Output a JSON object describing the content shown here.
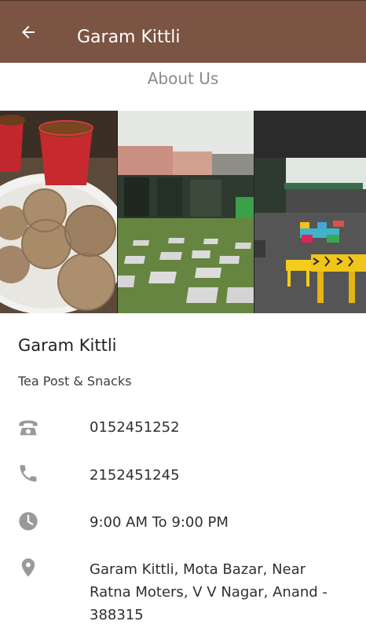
{
  "appbar": {
    "title": "Garam Kittli",
    "back_icon": "arrow-back-icon",
    "color": "#7b5444"
  },
  "section_title": "About Us",
  "gallery": {
    "images": [
      {
        "name": "tea-and-cookies-photo"
      },
      {
        "name": "courtyard-photo"
      },
      {
        "name": "seating-area-photo"
      }
    ]
  },
  "business": {
    "name": "Garam Kittli",
    "category": "Tea Post & Snacks"
  },
  "contact": {
    "landline": {
      "icon": "telephone-icon",
      "value": "0152451252"
    },
    "mobile": {
      "icon": "phone-icon",
      "value": "2152451245"
    },
    "hours": {
      "icon": "clock-icon",
      "value": "9:00 AM To 9:00 PM"
    },
    "address": {
      "icon": "location-pin-icon",
      "value": "Garam Kittli, Mota Bazar, Near Ratna Moters, V V Nagar, Anand - 388315"
    }
  }
}
